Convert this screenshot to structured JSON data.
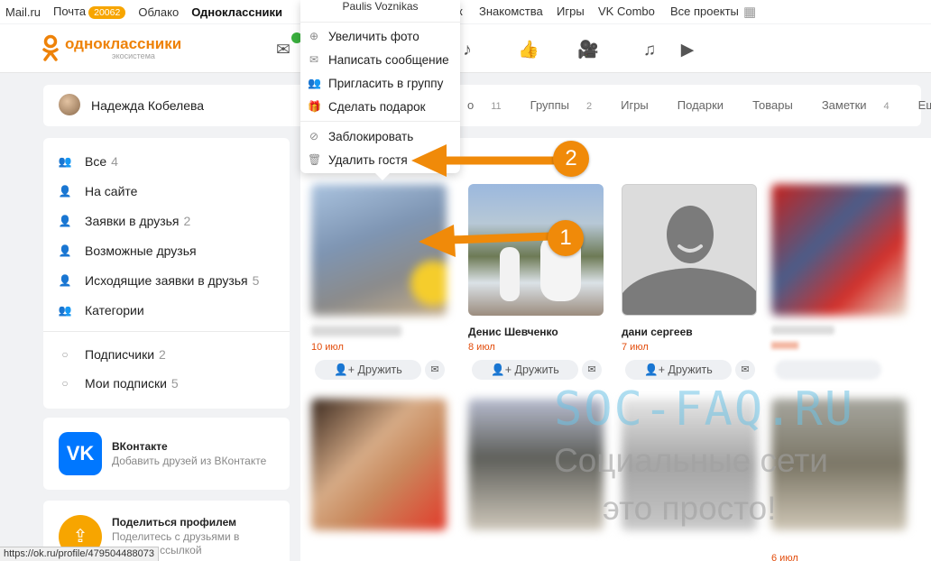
{
  "topbar": {
    "mailru": "Mail.ru",
    "pochta": "Почта",
    "pochta_count": "20062",
    "oblako": "Облако",
    "ok": "Одноклассники",
    "k": "к",
    "znakomstva": "Знакомства",
    "igry": "Игры",
    "vkcombo": "VK Combo",
    "all": "Все проекты"
  },
  "logo": {
    "name": "одноклассники",
    "sub": "экосистема"
  },
  "profile": {
    "name": "Надежда Кобелева",
    "tabs": [
      {
        "label": "о",
        "count": "11"
      },
      {
        "label": "Группы",
        "count": "2"
      },
      {
        "label": "Игры",
        "count": ""
      },
      {
        "label": "Подарки",
        "count": ""
      },
      {
        "label": "Товары",
        "count": ""
      },
      {
        "label": "Заметки",
        "count": "4"
      },
      {
        "label": "Ещё",
        "count": ""
      }
    ]
  },
  "sidebar": {
    "items": [
      {
        "label": "Все",
        "count": "4"
      },
      {
        "label": "На сайте",
        "count": ""
      },
      {
        "label": "Заявки в друзья",
        "count": "2"
      },
      {
        "label": "Возможные друзья",
        "count": ""
      },
      {
        "label": "Исходящие заявки в друзья",
        "count": "5"
      },
      {
        "label": "Категории",
        "count": ""
      },
      {
        "label": "Подписчики",
        "count": "2"
      },
      {
        "label": "Мои подписки",
        "count": "5"
      }
    ]
  },
  "vk": {
    "logo": "VK",
    "title": "ВКонтакте",
    "sub": "Добавить друзей из ВКонтакте"
  },
  "share": {
    "title": "Поделиться профилем",
    "sub": "Поделитесь с друзьями в соцсетях ссылкой"
  },
  "cards": [
    {
      "name": "",
      "date": "10 июл",
      "add": "Дружить"
    },
    {
      "name": "Денис Шевченко",
      "date": "8 июл",
      "add": "Дружить"
    },
    {
      "name": "дани сергеев",
      "date": "7 июл",
      "add": "Дружить"
    },
    {
      "name": "",
      "date": "",
      "add": ""
    }
  ],
  "row2_dates": [
    "",
    "",
    "",
    "6 июл"
  ],
  "menu": {
    "head": "Paulis Voznikas",
    "items": [
      {
        "label": "Увеличить фото",
        "icon": "zoom-icon"
      },
      {
        "label": "Написать сообщение",
        "icon": "mail-icon"
      },
      {
        "label": "Пригласить в группу",
        "icon": "group-icon"
      },
      {
        "label": "Сделать подарок",
        "icon": "gift-icon"
      },
      {
        "label": "Заблокировать",
        "icon": "block-icon"
      },
      {
        "label": "Удалить гостя",
        "icon": "trash-icon"
      }
    ]
  },
  "annotations": {
    "n1": "1",
    "n2": "2",
    "color": "#f08a09"
  },
  "watermark": {
    "line1": "SOC-FAQ.RU",
    "line2": "Социальные сети",
    "line3": "это просто!"
  },
  "statusbar": "https://ok.ru/profile/479504488073",
  "colors": {
    "brand": "#ee8208",
    "date": "#e24b0a",
    "vk": "#0077ff"
  }
}
